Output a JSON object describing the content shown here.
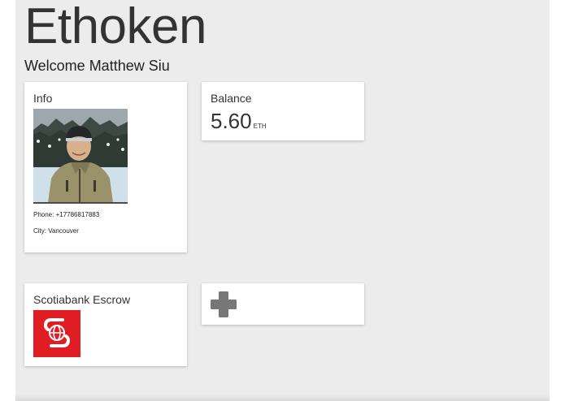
{
  "app": {
    "title": "Ethoken",
    "welcome": "Welcome Matthew Siu"
  },
  "info_card": {
    "title": "Info",
    "phone": "Phone: +17786817883",
    "city": "City: Vancouver"
  },
  "balance_card": {
    "title": "Balance",
    "value": "5.60",
    "unit": "ETH"
  },
  "escrow_card": {
    "title": "Scotiabank Escrow",
    "logo_color": "#e01d23"
  },
  "add_card": {
    "icon": "plus-icon",
    "icon_color": "#777777"
  },
  "colors": {
    "background": "#ececec",
    "card": "#ffffff",
    "text": "#333333"
  }
}
